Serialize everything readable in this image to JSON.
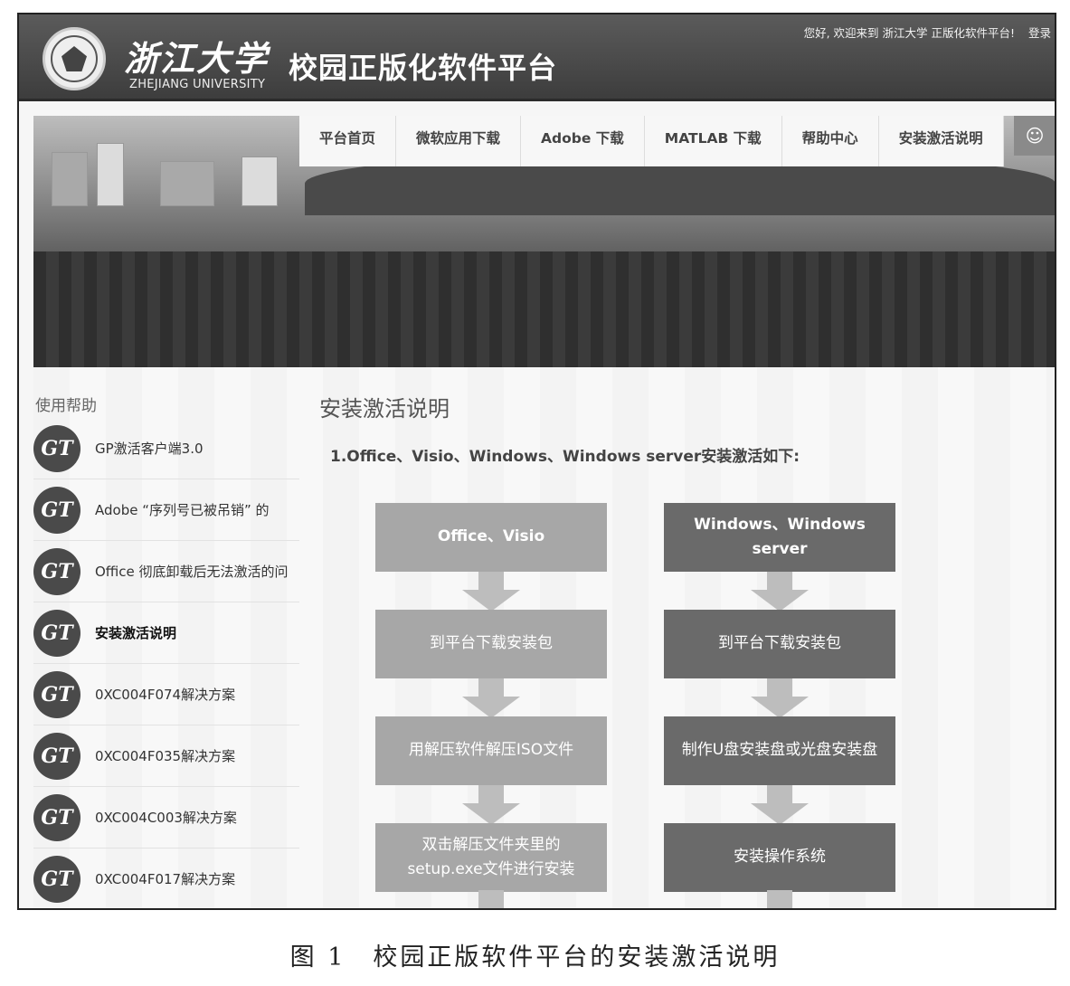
{
  "header": {
    "logo_cn": "浙江大学",
    "logo_en": "ZHEJIANG UNIVERSITY",
    "site_title": "校园正版化软件平台",
    "welcome": "您好, 欢迎来到 浙江大学 正版化软件平台!",
    "login": "登录"
  },
  "nav": {
    "items": [
      "平台首页",
      "微软应用下载",
      "Adobe 下载",
      "MATLAB 下载",
      "帮助中心",
      "安装激活说明"
    ],
    "icon": "smiley-icon"
  },
  "sidebar": {
    "title": "使用帮助",
    "items": [
      {
        "label": "GP激活客户端3.0"
      },
      {
        "label": "Adobe “序列号已被吊销” 的"
      },
      {
        "label": "Office 彻底卸载后无法激活的问"
      },
      {
        "label": "安装激活说明"
      },
      {
        "label": "0XC004F074解决方案"
      },
      {
        "label": "0XC004F035解决方案"
      },
      {
        "label": "0XC004C003解决方案"
      },
      {
        "label": "0XC004F017解决方案"
      }
    ],
    "active_index": 3
  },
  "main": {
    "title": "安装激活说明",
    "section_head": "1.Office、Visio、Windows、Windows server安装激活如下:",
    "flow_left": [
      "Office、Visio",
      "到平台下载安装包",
      "用解压软件解压ISO文件",
      "双击解压文件夹里的setup.exe文件进行安装"
    ],
    "flow_right": [
      "Windows、Windows server",
      "到平台下载安装包",
      "制作U盘安装盘或光盘安装盘",
      "安装操作系统"
    ]
  },
  "caption": "图 1　校园正版软件平台的安装激活说明"
}
